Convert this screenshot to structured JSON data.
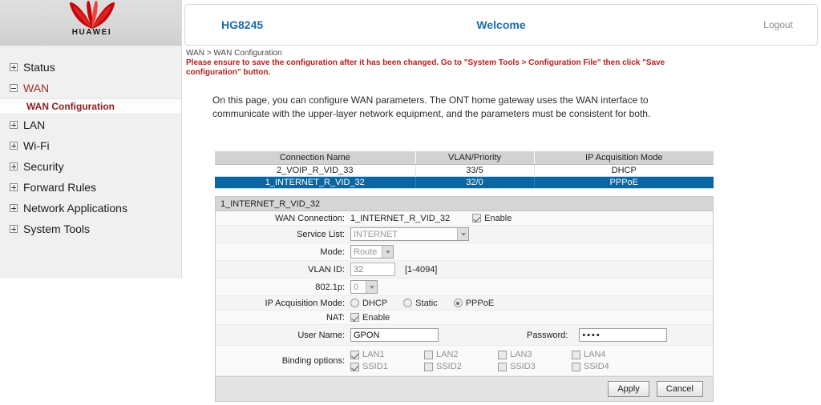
{
  "brand": {
    "logo_text": "HUAWEI",
    "logo_icon": "huawei-flower-logo",
    "accent_red": "#c7000b"
  },
  "sidebar": {
    "items": [
      {
        "label": "Status",
        "expanded": false
      },
      {
        "label": "WAN",
        "expanded": true
      },
      {
        "label": "LAN",
        "expanded": false
      },
      {
        "label": "Wi-Fi",
        "expanded": false
      },
      {
        "label": "Security",
        "expanded": false
      },
      {
        "label": "Forward Rules",
        "expanded": false
      },
      {
        "label": "Network Applications",
        "expanded": false
      },
      {
        "label": "System Tools",
        "expanded": false
      }
    ],
    "sub_item": "WAN Configuration"
  },
  "header": {
    "model": "HG8245",
    "welcome": "Welcome",
    "logout": "Logout",
    "link_color": "#1c6ca8"
  },
  "breadcrumb": "WAN > WAN Configuration",
  "warning": "Please ensure to save the configuration after it has been changed. Go to \"System Tools > Configuration File\" then click \"Save configuration\" button.",
  "warning_color": "#b42020",
  "intro": "On this page, you can configure WAN parameters. The ONT home gateway uses the WAN interface to communicate with the upper-layer network equipment, and the parameters must be consistent for both.",
  "table": {
    "columns": [
      "Connection Name",
      "VLAN/Priority",
      "IP Acquisition Mode"
    ],
    "rows": [
      {
        "name": "2_VOIP_R_VID_33",
        "vlan": "33/5",
        "mode": "DHCP",
        "selected": false
      },
      {
        "name": "1_INTERNET_R_VID_32",
        "vlan": "32/0",
        "mode": "PPPoE",
        "selected": true
      }
    ],
    "selected_row_color": "#0a66a3",
    "header_bg": "#d2d2d2"
  },
  "form": {
    "title": "1_INTERNET_R_VID_32",
    "wan_connection": {
      "label": "WAN Connection:",
      "value": "1_INTERNET_R_VID_32",
      "enable_label": "Enable",
      "enable_checked": true
    },
    "service_list": {
      "label": "Service List:",
      "value": "INTERNET"
    },
    "mode": {
      "label": "Mode:",
      "value": "Route"
    },
    "vlan_id": {
      "label": "VLAN ID:",
      "value": "32",
      "hint": "[1-4094]"
    },
    "p8021p": {
      "label": "802.1p:",
      "value": "0"
    },
    "ip_mode": {
      "label": "IP Acquisition Mode:",
      "options": [
        "DHCP",
        "Static",
        "PPPoE"
      ],
      "selected": "PPPoE"
    },
    "nat": {
      "label": "NAT:",
      "enable_label": "Enable",
      "checked": true
    },
    "user_name": {
      "label": "User Name:",
      "value": "GPON"
    },
    "password": {
      "label": "Password:",
      "value": "••••"
    },
    "binding": {
      "label": "Binding options:",
      "options": [
        {
          "label": "LAN1",
          "checked": true
        },
        {
          "label": "LAN2",
          "checked": false
        },
        {
          "label": "LAN3",
          "checked": false
        },
        {
          "label": "LAN4",
          "checked": false
        },
        {
          "label": "SSID1",
          "checked": true
        },
        {
          "label": "SSID2",
          "checked": false
        },
        {
          "label": "SSID3",
          "checked": false
        },
        {
          "label": "SSID4",
          "checked": false
        }
      ]
    },
    "apply_label": "Apply",
    "cancel_label": "Cancel"
  }
}
